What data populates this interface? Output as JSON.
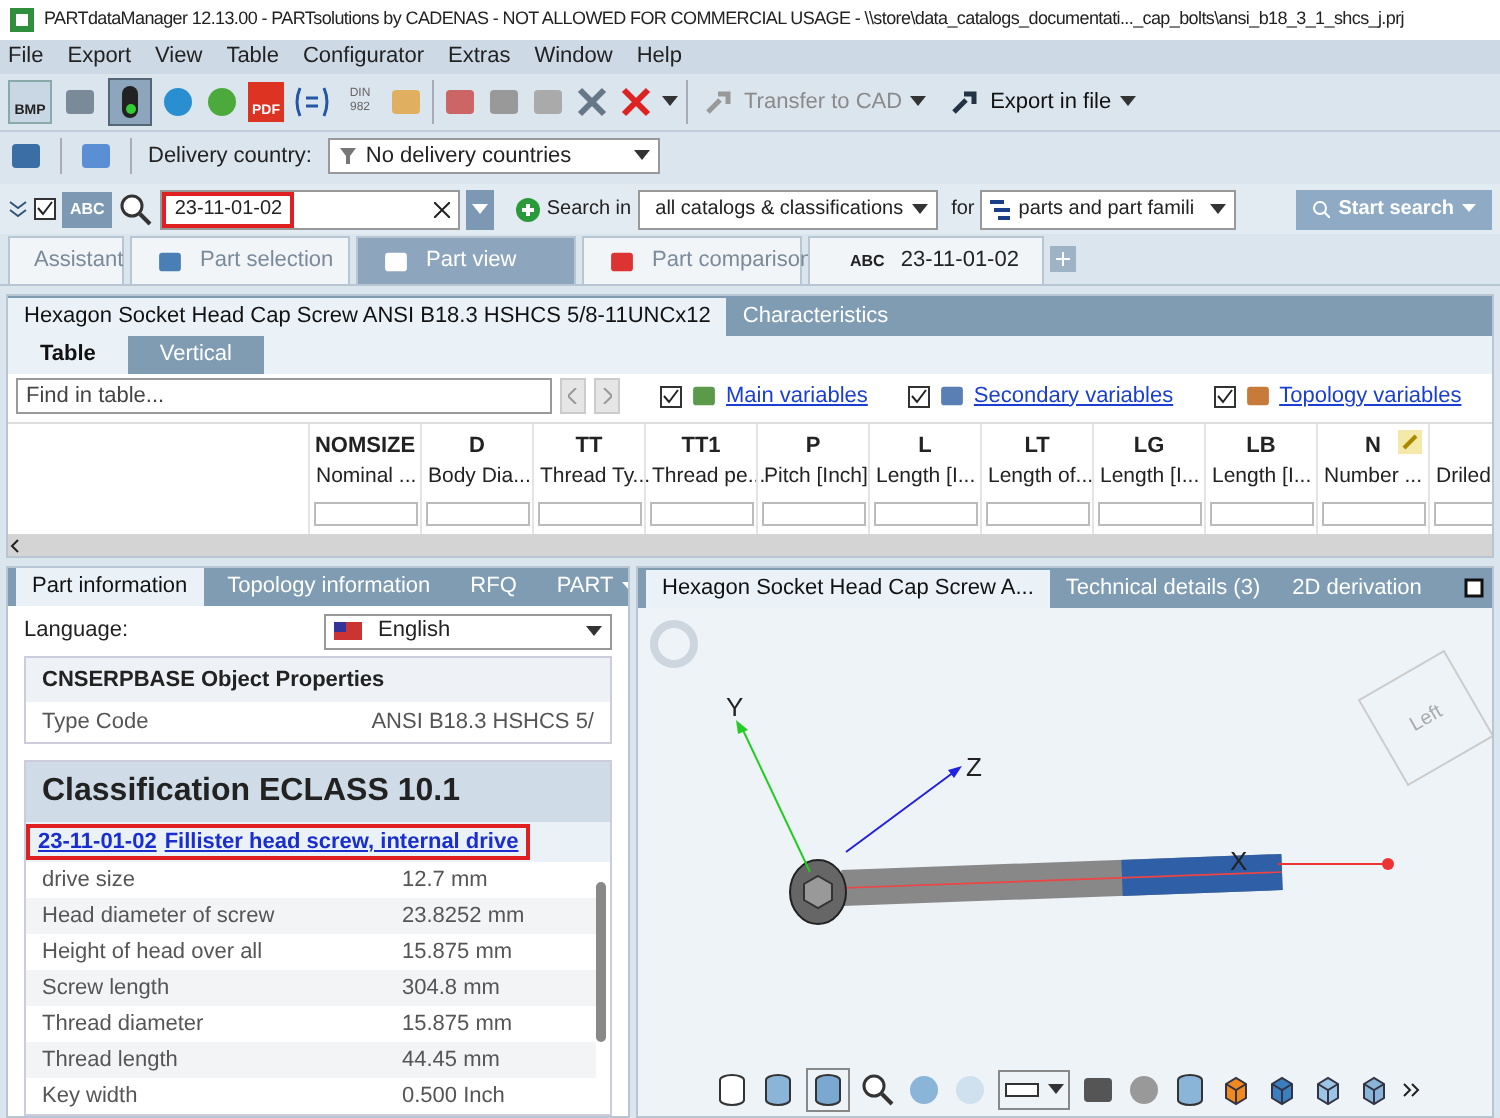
{
  "window": {
    "title": "PARTdataManager 12.13.00 - PARTsolutions by CADENAS - NOT ALLOWED FOR COMMERCIAL USAGE - \\\\store\\data_catalogs_documentati..._cap_bolts\\ansi_b18_3_1_shcs_j.prj"
  },
  "menu": [
    "File",
    "Export",
    "View",
    "Table",
    "Configurator",
    "Extras",
    "Window",
    "Help"
  ],
  "toolbar": {
    "icon_labels": [
      "BMP",
      "PDF",
      "DIN 982"
    ],
    "buttons": [
      {
        "label": "Transfer to CAD",
        "disabled": true
      },
      {
        "label": "Export in file",
        "disabled": false
      }
    ]
  },
  "delivery": {
    "label": "Delivery country:",
    "value": "No delivery countries"
  },
  "search": {
    "checked": true,
    "mode": "ABC",
    "query": "23-11-01-02",
    "search_in_label": "Search in",
    "scope": "all catalogs & classifications",
    "for_label": "for",
    "target": "parts and part famili",
    "button": "Start search"
  },
  "tabs": [
    {
      "label": "Assistant",
      "selected": false
    },
    {
      "label": "Part selection",
      "selected": false
    },
    {
      "label": "Part view",
      "selected": true
    },
    {
      "label": "Part comparison",
      "selected": false
    },
    {
      "prefix": "ABC",
      "label": "23-11-01-02",
      "selected": false
    }
  ],
  "part_panel": {
    "tabs": [
      {
        "label": "Hexagon Socket Head Cap Screw ANSI B18.3 HSHCS 5/8-11UNCx12",
        "selected": true
      },
      {
        "label": "Characteristics",
        "selected": false
      }
    ],
    "subtabs": [
      {
        "label": "Table",
        "selected": true
      },
      {
        "label": "Vertical",
        "selected": false
      }
    ],
    "find_placeholder": "Find in table...",
    "filters": [
      {
        "label": "Main variables",
        "checked": true
      },
      {
        "label": "Secondary variables",
        "checked": true
      },
      {
        "label": "Topology variables",
        "checked": true
      }
    ],
    "columns": [
      {
        "name": "NOMSIZE",
        "desc": "Nominal ..."
      },
      {
        "name": "D",
        "desc": "Body Dia..."
      },
      {
        "name": "TT",
        "desc": "Thread Ty..."
      },
      {
        "name": "TT1",
        "desc": "Thread pe..."
      },
      {
        "name": "P",
        "desc": "Pitch [Inch]"
      },
      {
        "name": "L",
        "desc": "Length [I..."
      },
      {
        "name": "LT",
        "desc": "Length of..."
      },
      {
        "name": "LG",
        "desc": "Length [I..."
      },
      {
        "name": "LB",
        "desc": "Length [I..."
      },
      {
        "name": "N",
        "desc": "Number ..."
      },
      {
        "desc": "Driled"
      }
    ]
  },
  "info_panel": {
    "tabs": [
      {
        "label": "Part information",
        "selected": true
      },
      {
        "label": "Topology information",
        "selected": false
      },
      {
        "label": "RFQ",
        "selected": false
      },
      {
        "label": "PART",
        "selected": false
      }
    ],
    "language_label": "Language:",
    "language": "English",
    "object_properties": {
      "title": "CNSERPBASE Object Properties",
      "rows": [
        {
          "name": "Type Code",
          "value": "ANSI B18.3 HSHCS 5/"
        }
      ]
    },
    "classification": {
      "title": "Classification ECLASS 10.1",
      "code": "23-11-01-02",
      "description": "Fillister head screw, internal drive",
      "rows": [
        {
          "name": "drive size",
          "value": "12.7 mm"
        },
        {
          "name": "Head diameter of screw",
          "value": "23.8252 mm"
        },
        {
          "name": "Height of head over all",
          "value": "15.875 mm"
        },
        {
          "name": "Screw length",
          "value": "304.8 mm"
        },
        {
          "name": "Thread diameter",
          "value": "15.875 mm"
        },
        {
          "name": "Thread length",
          "value": "44.45 mm"
        },
        {
          "name": "Key width",
          "value": "0.500 Inch"
        }
      ]
    }
  },
  "viewer": {
    "tabs": [
      {
        "label": "Hexagon Socket Head Cap Screw A...",
        "selected": true
      },
      {
        "label": "Technical details (3)",
        "selected": false
      },
      {
        "label": "2D derivation",
        "selected": false
      }
    ],
    "axes": {
      "x": "X",
      "y": "Y",
      "z": "Z"
    },
    "cube_label": "Left"
  }
}
